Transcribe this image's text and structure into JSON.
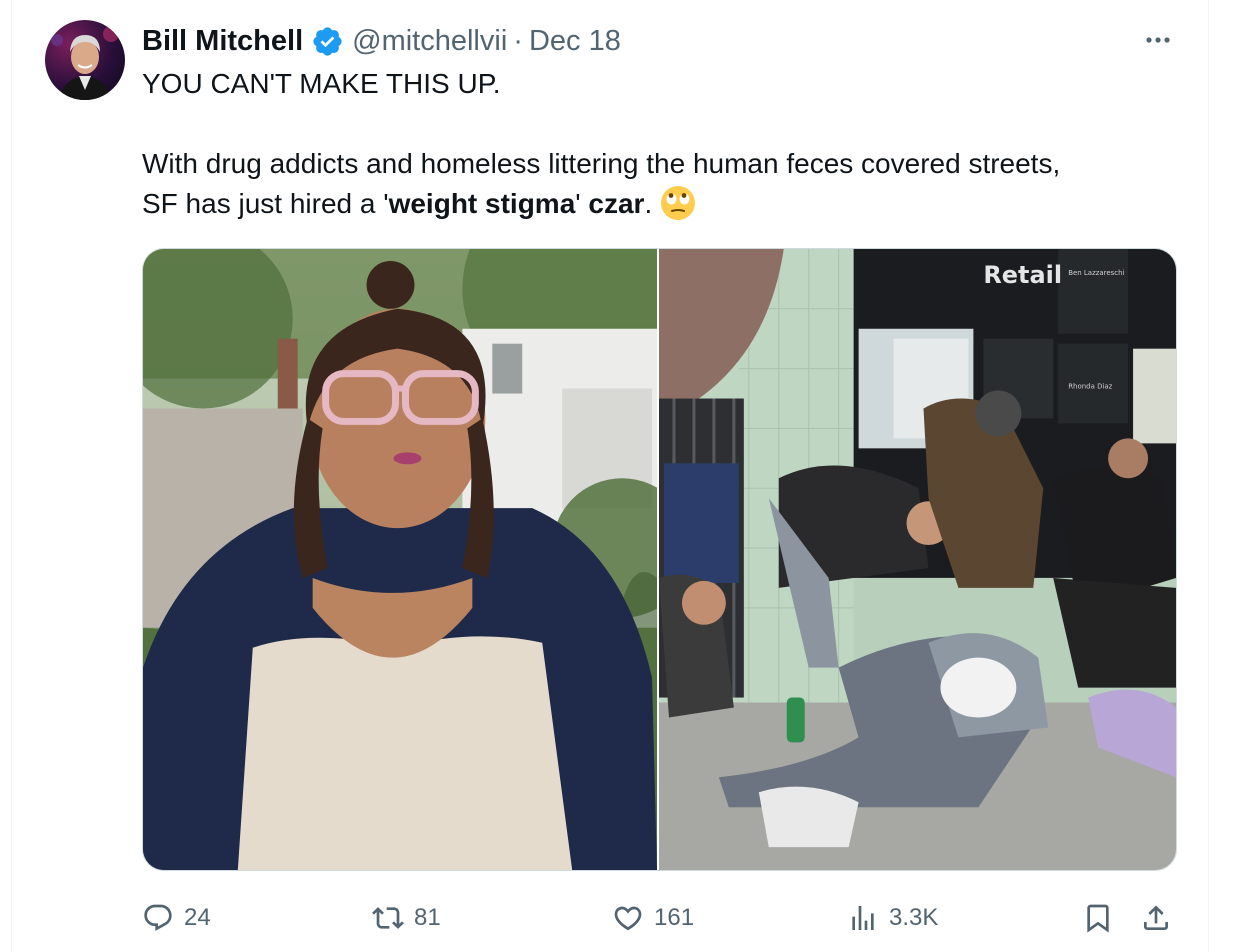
{
  "tweet": {
    "author": {
      "display_name": "Bill Mitchell",
      "handle": "@mitchellvii",
      "verified": true,
      "verified_color": "#1d9bf0"
    },
    "separator": "·",
    "date": "Dec 18",
    "text": {
      "line1": "YOU CAN'T MAKE THIS UP.",
      "line2": "With drug addicts and homeless littering the human feces covered streets,",
      "line3_prefix": "SF has just hired a '",
      "line3_bold1": "weight stigma",
      "line3_mid": "' ",
      "line3_bold2": "czar",
      "line3_suffix": ".",
      "emoji": "face-with-rolling-eyes"
    },
    "media": {
      "left_image_description_icon": "portrait-photo",
      "right_image_description_icon": "street-photo",
      "storefront_sign": "Retail",
      "storefront_sign_small": "Ben Lazzareschi",
      "storefront_card": "Rhonda Diaz"
    },
    "actions": {
      "replies": "24",
      "retweets": "81",
      "likes": "161",
      "views": "3.3K"
    }
  },
  "colors": {
    "text_primary": "#0f1419",
    "text_secondary": "#536471",
    "border": "#cfd9de"
  }
}
